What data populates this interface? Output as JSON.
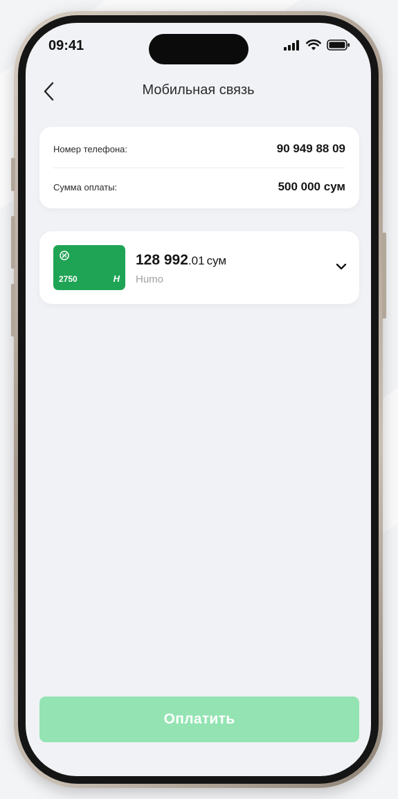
{
  "status_bar": {
    "time": "09:41"
  },
  "header": {
    "title": "Мобильная связь",
    "back_icon": "chevron-left-icon"
  },
  "payment_info": {
    "rows": [
      {
        "label": "Номер телефона:",
        "value": "90 949 88 09"
      },
      {
        "label": "Сумма оплаты:",
        "value": "500 000 сум"
      }
    ]
  },
  "card": {
    "last_digits": "2750",
    "balance_integer": "128 992",
    "balance_fraction": ".01",
    "currency": "сум",
    "type": "Humo",
    "color": "#1fa455"
  },
  "pay_button": {
    "label": "Оплатить",
    "color": "#93e4b2"
  }
}
